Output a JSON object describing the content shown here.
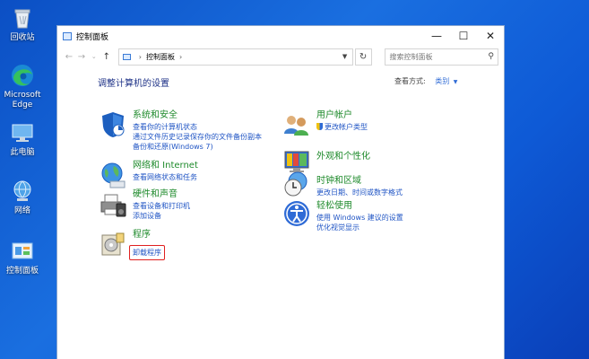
{
  "desktop": {
    "icons": [
      {
        "label": "回收站"
      },
      {
        "label": "Microsoft Edge"
      },
      {
        "label": "此电脑"
      },
      {
        "label": "网络"
      },
      {
        "label": "控制面板"
      }
    ]
  },
  "window": {
    "title": "控制面板",
    "address": {
      "root_separator": "›",
      "crumb": "控制面板",
      "trailing_separator": "›"
    },
    "search_placeholder": "搜索控制面板",
    "heading": "调整计算机的设置",
    "view_by_label": "查看方式:",
    "view_by_value": "类别",
    "categories": [
      {
        "title": "系统和安全",
        "links": [
          "查看你的计算机状态",
          "通过文件历史记录保存你的文件备份副本",
          "备份和还原(Windows 7)"
        ]
      },
      {
        "title": "网络和 Internet",
        "links": [
          "查看网络状态和任务"
        ]
      },
      {
        "title": "硬件和声音",
        "links": [
          "查看设备和打印机",
          "添加设备"
        ]
      },
      {
        "title": "程序",
        "links": [
          "卸载程序"
        ]
      },
      {
        "title": "用户帐户",
        "links": [
          "更改帐户类型"
        ]
      },
      {
        "title": "外观和个性化",
        "links": []
      },
      {
        "title": "时钟和区域",
        "links": [
          "更改日期、时间或数字格式"
        ]
      },
      {
        "title": "轻松使用",
        "links": [
          "使用 Windows 建议的设置",
          "优化视觉显示"
        ]
      }
    ]
  },
  "colors": {
    "accent": "#2f6bd6",
    "category_title": "#1e8a2b",
    "link": "#1f54c4",
    "highlight": "#e02020"
  }
}
